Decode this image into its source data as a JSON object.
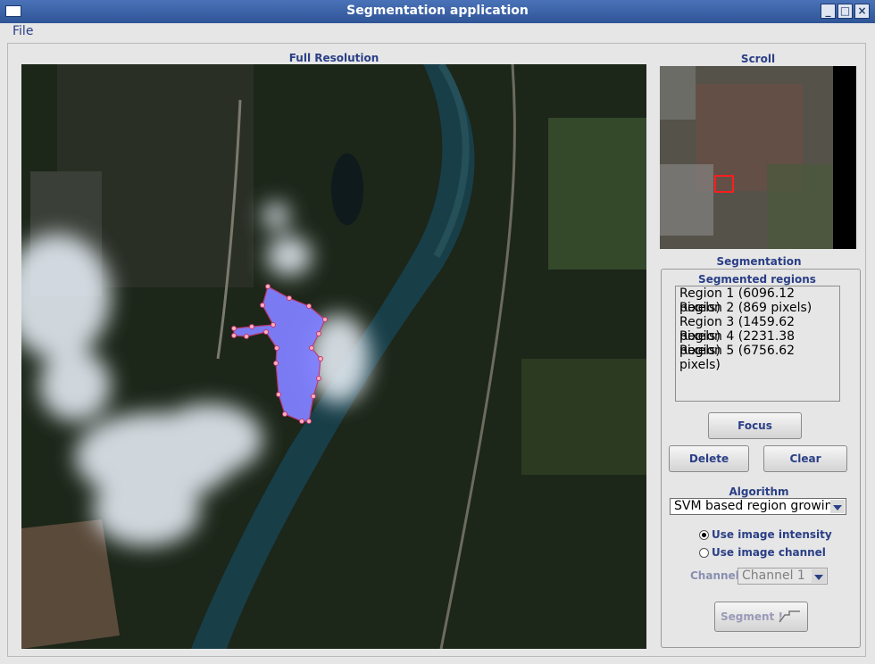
{
  "window": {
    "title": "Segmentation application"
  },
  "menu": {
    "file": "File"
  },
  "main_view": {
    "caption": "Full Resolution"
  },
  "scroll_view": {
    "caption": "Scroll"
  },
  "segmentation": {
    "caption": "Segmentation",
    "regions_caption": "Segmented regions",
    "regions": [
      "Region 1 (6096.12 pixels)",
      "Region 2 (869 pixels)",
      "Region 3 (1459.62 pixels)",
      "Region 4 (2231.38 pixels)",
      "Region 5 (6756.62 pixels)"
    ],
    "focus_label": "Focus",
    "delete_label": "Delete",
    "clear_label": "Clear",
    "algorithm_caption": "Algorithm",
    "algorithm_value": "SVM based region growing",
    "option_intensity": "Use image intensity",
    "option_channel": "Use image channel",
    "channel_caption": "Channel",
    "channel_value": "Channel 1",
    "segment_label": "Segment !"
  },
  "colors": {
    "title_bar": "#2f5597",
    "label": "#2a3f86",
    "region_fill": "#8080ff",
    "roi_box": "#ff1e1e"
  }
}
